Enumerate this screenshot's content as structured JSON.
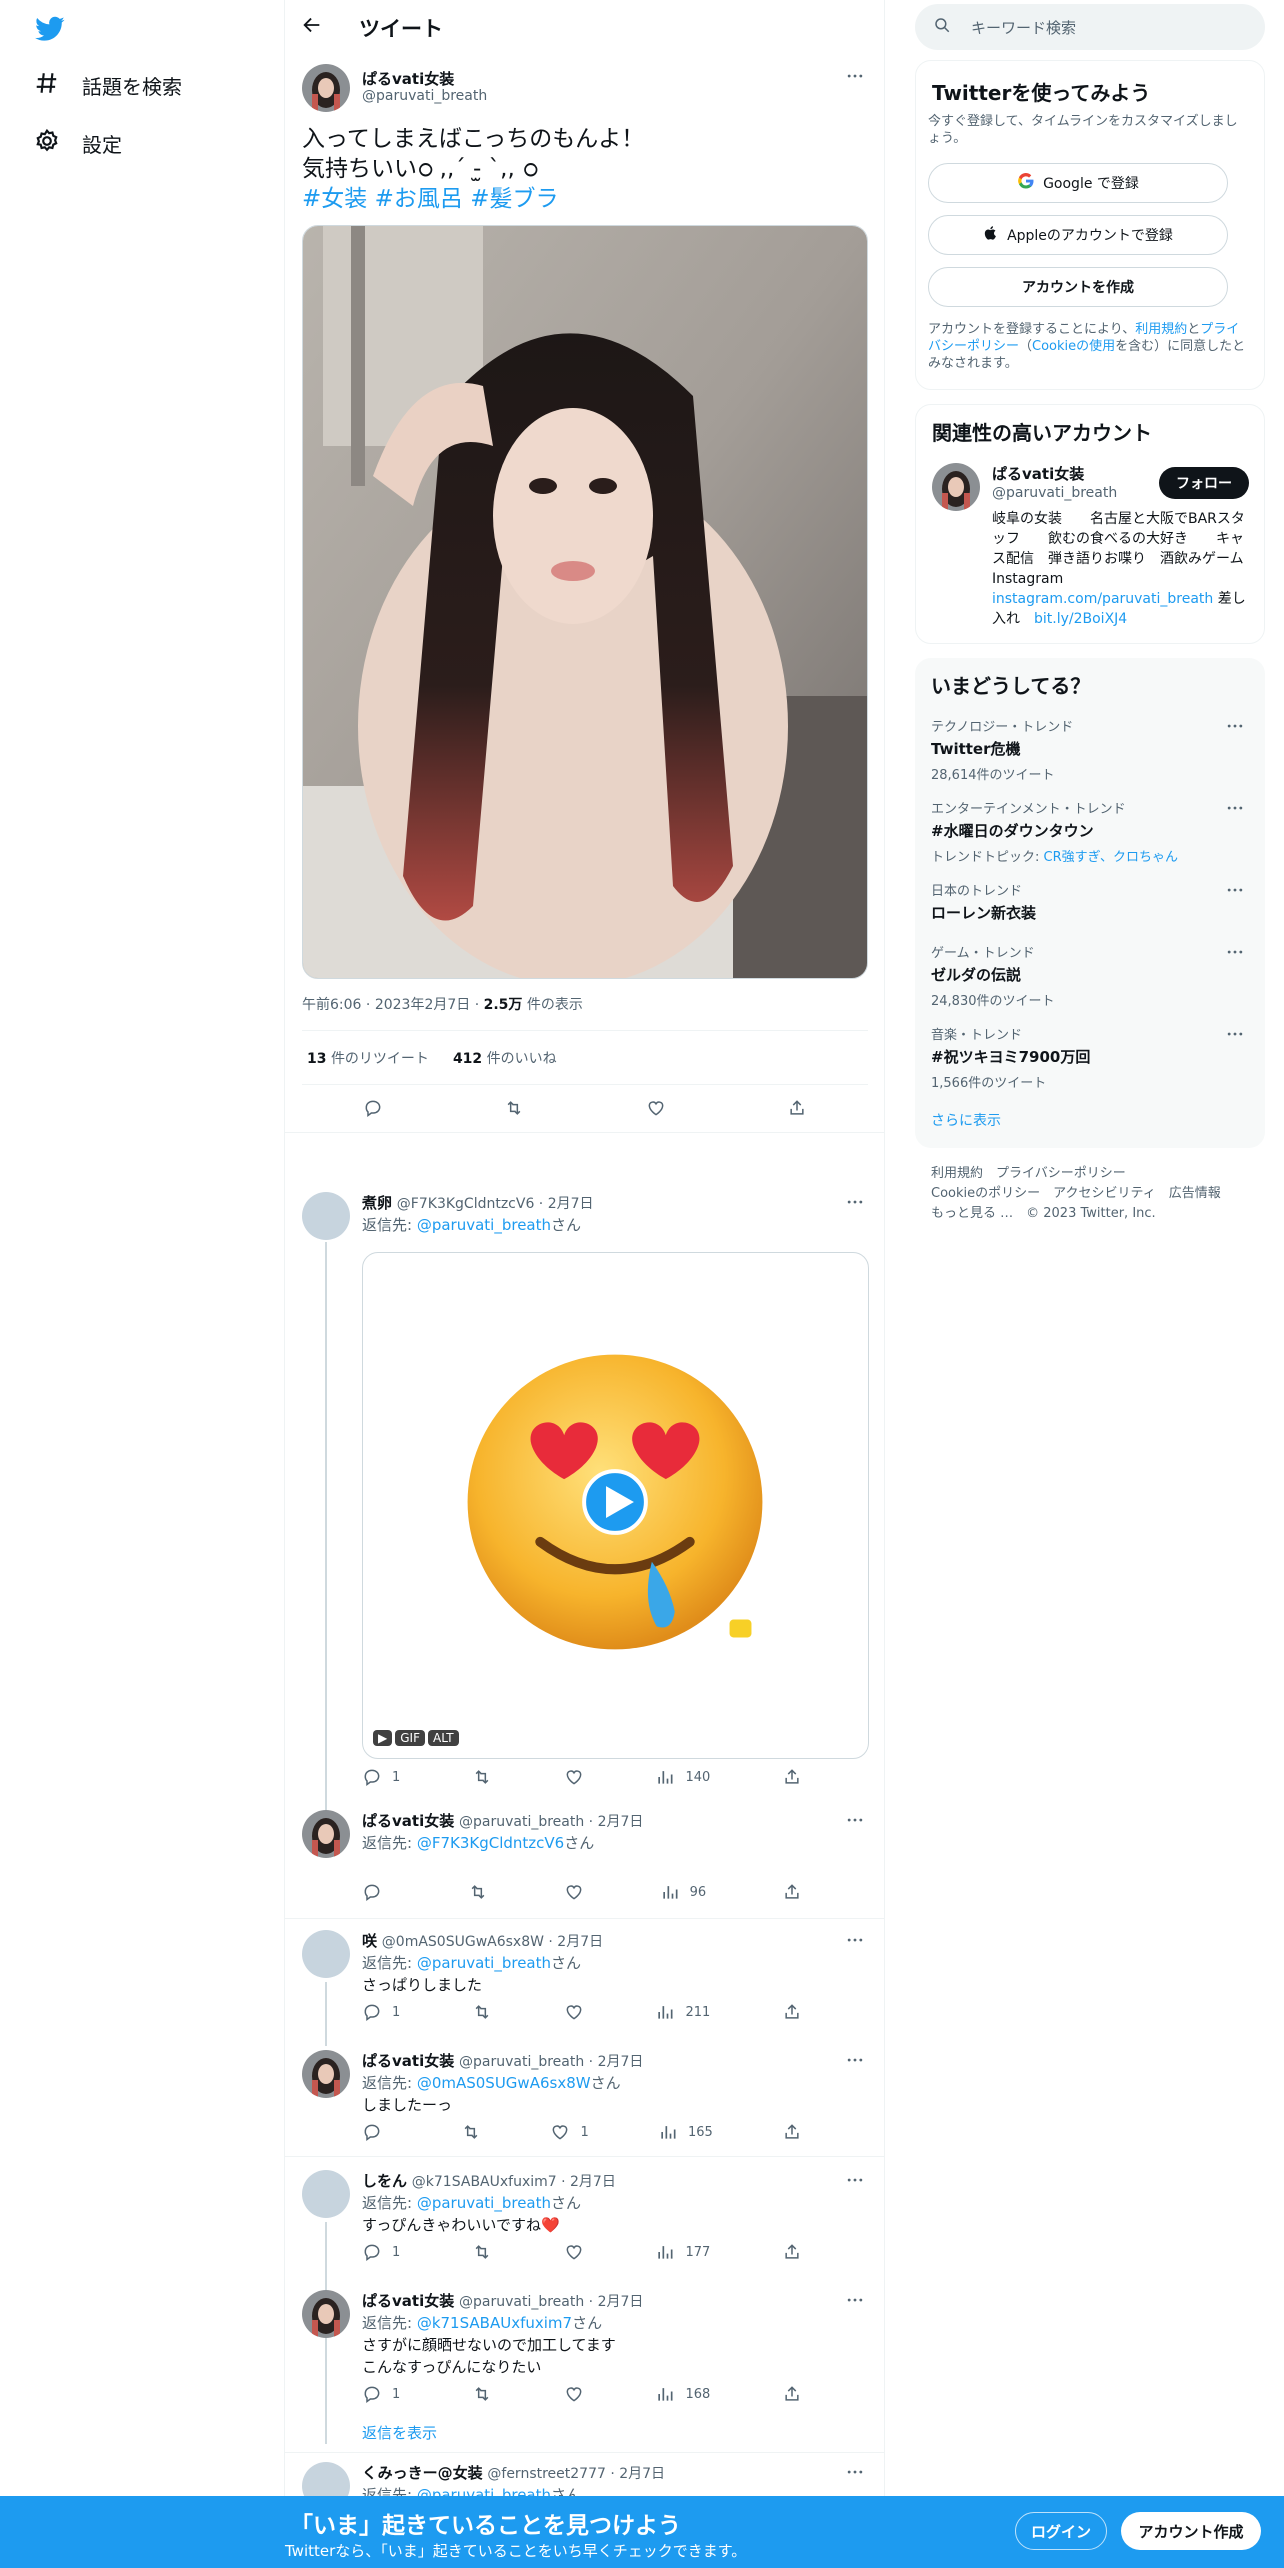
{
  "nav": {
    "explore_label": "話題を検索",
    "settings_label": "設定"
  },
  "header": {
    "title": "ツイート"
  },
  "tweet": {
    "name": "ぱるvati女装",
    "handle": "@paruvati_breath",
    "line1": "入ってしまえばこっちのもんよ！",
    "line2": "気持ちいいഠ ,,´ -̫ `,, ഠ",
    "hashtags": [
      "#女装",
      "#お風呂",
      "#髪ブラ"
    ],
    "time": "午前6:06",
    "date": "2023年2月7日",
    "views_count": "2.5万",
    "views_label": "件の表示",
    "retweets_count": "13",
    "retweets_label": "件のリツイート",
    "likes_count": "412",
    "likes_label": "件のいいね"
  },
  "replies": [
    {
      "name": "煮卵",
      "meta": "@F7K3KgCldntzcV6 · 2月7日",
      "reply_prefix": "返信先: ",
      "reply_to": "@paruvati_breath",
      "reply_suffix": "さん",
      "text": "",
      "gif_badges": [
        "▶",
        "GIF",
        "ALT"
      ],
      "reply_count": "1",
      "like_count": "",
      "views": "140"
    },
    {
      "name": "ぱるvati女装",
      "meta": "@paruvati_breath · 2月7日",
      "reply_prefix": "返信先: ",
      "reply_to": "@F7K3KgCldntzcV6",
      "reply_suffix": "さん",
      "text": "",
      "reply_count": "",
      "like_count": "",
      "views": "96"
    },
    {
      "name": "咲",
      "meta": "@0mAS0SUGwA6sx8W · 2月7日",
      "reply_prefix": "返信先: ",
      "reply_to": "@paruvati_breath",
      "reply_suffix": "さん",
      "text": "さっぱりしました",
      "reply_count": "1",
      "like_count": "",
      "views": "211"
    },
    {
      "name": "ぱるvati女装",
      "meta": "@paruvati_breath · 2月7日",
      "reply_prefix": "返信先: ",
      "reply_to": "@0mAS0SUGwA6sx8W",
      "reply_suffix": "さん",
      "text": "しましたーっ",
      "reply_count": "",
      "like_count": "1",
      "views": "165"
    },
    {
      "name": "しをん",
      "meta": "@k71SABAUxfuxim7 · 2月7日",
      "reply_prefix": "返信先: ",
      "reply_to": "@paruvati_breath",
      "reply_suffix": "さん",
      "text": "すっぴんきゃわいいですね❤️",
      "reply_count": "1",
      "like_count": "",
      "views": "177"
    },
    {
      "name": "ぱるvati女装",
      "meta": "@paruvati_breath · 2月7日",
      "reply_prefix": "返信先: ",
      "reply_to": "@k71SABAUxfuxim7",
      "reply_suffix": "さん",
      "text_line1": "さすがに顔晒せないので加工してます",
      "text_line2": "こんなすっぴんになりたい",
      "reply_count": "1",
      "like_count": "",
      "views": "168"
    },
    {
      "name": "くみっきー@女装",
      "meta": "@fernstreet2777 · 2月7日",
      "reply_prefix": "返信先: ",
      "reply_to": "@paruvati_breath",
      "reply_suffix": "さん"
    }
  ],
  "show_replies": "返信を表示",
  "right": {
    "search_placeholder": "キーワード検索",
    "signup_card": {
      "title": "Twitterを使ってみよう",
      "subtitle": "今すぐ登録して、タイムラインをカスタマイズしましょう。",
      "google_btn": "Google で登録",
      "apple_btn": "Appleのアカウントで登録",
      "create_btn": "アカウントを作成",
      "terms_prefix": "アカウントを登録することにより、",
      "terms_link": "利用規約",
      "terms_and": "と",
      "privacy_link": "プライバシーポリシー",
      "paren_open": "（",
      "cookie_link": "Cookieの使用",
      "terms_suffix": "を含む）に同意したとみなされます。"
    },
    "related": {
      "title": "関連性の高いアカウント",
      "name": "ぱるvati女装",
      "handle": "@paruvati_breath",
      "follow": "フォロー",
      "bio1": "岐阜の女装　　名古屋と大阪でBARスタッフ　　飲むの食べるの大好き　　キャス配信　弾き語りお喋り　酒飲みゲーム　Instagram",
      "bio_link1": "instagram.com/paruvati_breath",
      "bio2": " 差し入れ　",
      "bio_link2": "bit.ly/2BoiXJ4"
    },
    "trends": {
      "title": "いまどうしてる？",
      "items": [
        {
          "category": "テクノロジー・トレンド",
          "name": "Twitter危機",
          "count": "28,614件のツイート",
          "topic_prefix": "",
          "topic": ""
        },
        {
          "category": "エンターテインメント・トレンド",
          "name": "#水曜日のダウンタウン",
          "count": "",
          "topic_prefix": "トレンドトピック: ",
          "topic": "CR強すぎ、クロちゃん"
        },
        {
          "category": "日本のトレンド",
          "name": "ローレン新衣装",
          "count": "",
          "topic_prefix": "",
          "topic": ""
        },
        {
          "category": "ゲーム・トレンド",
          "name": "ゼルダの伝説",
          "count": "24,830件のツイート",
          "topic_prefix": "",
          "topic": ""
        },
        {
          "category": "音楽・トレンド",
          "name": "#祝ツキヨミ7900万回",
          "count": "1,566件のツイート",
          "topic_prefix": "",
          "topic": ""
        }
      ],
      "show_more": "さらに表示"
    },
    "footer": {
      "row1": "利用規約　プライバシーポリシー",
      "row2": "Cookieのポリシー　アクセシビリティ　広告情報",
      "row3": "もっと見る …　© 2023 Twitter, Inc."
    }
  },
  "bottom_bar": {
    "title": "「いま」起きていることを見つけよう",
    "subtitle": "Twitterなら、「いま」起きていることをいち早くチェックできます。",
    "login": "ログイン",
    "signup": "アカウント作成"
  },
  "colors": {
    "accent": "#1d9bf0",
    "text": "#0f1419",
    "muted": "#536471",
    "like_red": "#f91880"
  }
}
